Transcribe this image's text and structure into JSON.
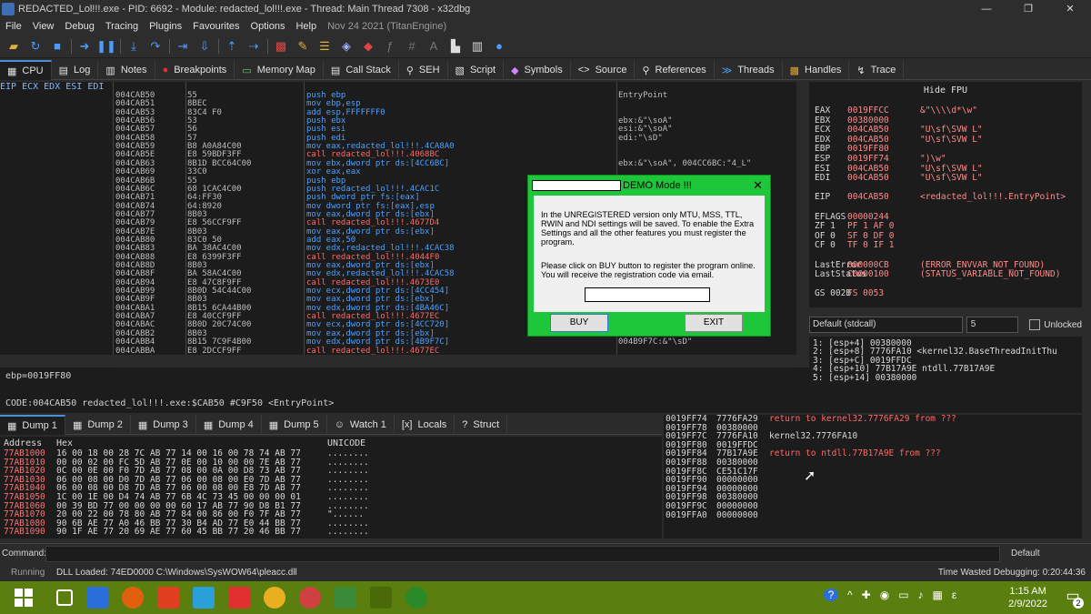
{
  "window": {
    "title": "REDACTED_Lol!!!.exe - PID: 6692 - Module: redacted_lol!!!.exe - Thread: Main Thread 7308 - x32dbg",
    "min": "—",
    "max": "❐",
    "close": "✕"
  },
  "menu": {
    "items": [
      "File",
      "View",
      "Debug",
      "Tracing",
      "Plugins",
      "Favourites",
      "Options",
      "Help"
    ],
    "date": "Nov 24 2021 (TitanEngine)"
  },
  "tabs": [
    {
      "label": "CPU",
      "icon": "▦"
    },
    {
      "label": "Log",
      "icon": "▤"
    },
    {
      "label": "Notes",
      "icon": "▥"
    },
    {
      "label": "Breakpoints",
      "icon": "●"
    },
    {
      "label": "Memory Map",
      "icon": "▭"
    },
    {
      "label": "Call Stack",
      "icon": "▤"
    },
    {
      "label": "SEH",
      "icon": "⚲"
    },
    {
      "label": "Script",
      "icon": "▧"
    },
    {
      "label": "Symbols",
      "icon": "◆"
    },
    {
      "label": "Source",
      "icon": "<>"
    },
    {
      "label": "References",
      "icon": "⚲"
    },
    {
      "label": "Threads",
      "icon": "≫"
    },
    {
      "label": "Handles",
      "icon": "▩"
    },
    {
      "label": "Trace",
      "icon": "↯"
    }
  ],
  "disasm": {
    "reg_header": "EIP ECX EDX ESI EDI",
    "rows": [
      {
        "a": "004CAB50",
        "b": "55",
        "i": "push ebp",
        "k": "push",
        "c": "EntryPoint"
      },
      {
        "a": "004CAB51",
        "b": "8BEC",
        "i": "mov ebp,esp",
        "k": "mov",
        "c": ""
      },
      {
        "a": "004CAB53",
        "b": "83C4 F0",
        "i": "add esp,FFFFFFF0",
        "k": "add",
        "c": ""
      },
      {
        "a": "004CAB56",
        "b": "53",
        "i": "push ebx",
        "k": "push",
        "c": "ebx:&\"\\soA\""
      },
      {
        "a": "004CAB57",
        "b": "56",
        "i": "push esi",
        "k": "push",
        "c": "esi:&\"\\soA\""
      },
      {
        "a": "004CAB58",
        "b": "57",
        "i": "push edi",
        "k": "push",
        "c": "edi:\"\\sD\""
      },
      {
        "a": "004CAB59",
        "b": "B8 A0A84C00",
        "i": "mov eax,redacted_lol!!!.4CA8A0",
        "k": "mov",
        "c": ""
      },
      {
        "a": "004CAB5E",
        "b": "E8 59BDF3FF",
        "i": "call redacted_lol!!!.4068BC",
        "k": "call",
        "c": ""
      },
      {
        "a": "004CAB63",
        "b": "8B1D BCC64C00",
        "i": "mov ebx,dword ptr ds:[4CC6BC]",
        "k": "mov",
        "c": "ebx:&\"\\soA\", 004CC6BC:\"4_L\""
      },
      {
        "a": "004CAB69",
        "b": "33C0",
        "i": "xor eax,eax",
        "k": "xor",
        "c": ""
      },
      {
        "a": "004CAB6B",
        "b": "55",
        "i": "push ebp",
        "k": "push",
        "c": ""
      },
      {
        "a": "004CAB6C",
        "b": "68 1CAC4C00",
        "i": "push redacted_lol!!!.4CAC1C",
        "k": "push",
        "c": ""
      },
      {
        "a": "004CAB71",
        "b": "64:FF30",
        "i": "push dword ptr fs:[eax]",
        "k": "push",
        "c": ""
      },
      {
        "a": "004CAB74",
        "b": "64:8920",
        "i": "mov dword ptr fs:[eax],esp",
        "k": "mov",
        "c": ""
      },
      {
        "a": "004CAB77",
        "b": "8B03",
        "i": "mov eax,dword ptr ds:[ebx]",
        "k": "mov",
        "c": ""
      },
      {
        "a": "004CAB79",
        "b": "E8 56CCF9FF",
        "i": "call redacted_lol!!!.4677D4",
        "k": "call",
        "c": ""
      },
      {
        "a": "004CAB7E",
        "b": "8B03",
        "i": "mov eax,dword ptr ds:[ebx]",
        "k": "mov",
        "c": ""
      },
      {
        "a": "004CAB80",
        "b": "83C0 50",
        "i": "add eax,50",
        "k": "add",
        "c": ""
      },
      {
        "a": "004CAB83",
        "b": "BA 38AC4C00",
        "i": "mov edx,redacted_lol!!!.4CAC38",
        "k": "mov",
        "c": "m\""
      },
      {
        "a": "004CAB88",
        "b": "E8 6399F3FF",
        "i": "call redacted_lol!!!.4044F0",
        "k": "call",
        "c": ""
      },
      {
        "a": "004CAB8D",
        "b": "8B03",
        "i": "mov eax,dword ptr ds:[ebx]",
        "k": "mov",
        "c": ""
      },
      {
        "a": "004CAB8F",
        "b": "BA 58AC4C00",
        "i": "mov edx,redacted_lol!!!.4CAC58",
        "k": "mov",
        "c": "28\""
      },
      {
        "a": "004CAB94",
        "b": "E8 47C8F9FF",
        "i": "call redacted_lol!!!.4673E0",
        "k": "call",
        "c": ""
      },
      {
        "a": "004CAB99",
        "b": "8B0D 54C44C00",
        "i": "mov ecx,dword ptr ds:[4CC454]",
        "k": "mov",
        "c": ""
      },
      {
        "a": "004CAB9F",
        "b": "8B03",
        "i": "mov eax,dword ptr ds:[ebx]",
        "k": "mov",
        "c": ""
      },
      {
        "a": "004CABA1",
        "b": "8B15 6CA44B00",
        "i": "mov edx,dword ptr ds:[4BA46C]",
        "k": "mov",
        "c": ""
      },
      {
        "a": "004CABA7",
        "b": "E8 40CCF9FF",
        "i": "call redacted_lol!!!.4677EC",
        "k": "call",
        "c": ""
      },
      {
        "a": "004CABAC",
        "b": "8B0D 20C74C00",
        "i": "mov ecx,dword ptr ds:[4CC720]",
        "k": "mov",
        "c": ""
      },
      {
        "a": "004CABB2",
        "b": "8B03",
        "i": "mov eax,dword ptr ds:[ebx]",
        "k": "mov",
        "c": ""
      },
      {
        "a": "004CABB4",
        "b": "8B15 7C9F4B00",
        "i": "mov edx,dword ptr ds:[4B9F7C]",
        "k": "mov",
        "c": "004B9F7C:&\"\\sD\""
      },
      {
        "a": "004CABBA",
        "b": "E8 2DCCF9FF",
        "i": "call redacted_lol!!!.4677EC",
        "k": "call",
        "c": ""
      }
    ]
  },
  "info": {
    "line1": "ebp=0019FF80",
    "line2": "CODE:004CAB50 redacted_lol!!!.exe:$CAB50 #C9F50 <EntryPoint>"
  },
  "registers": {
    "header": "Hide FPU",
    "rows": [
      {
        "n": "EAX",
        "v": "0019FFCC",
        "s": "&\"\\\\\\\\d*\\w\""
      },
      {
        "n": "EBX",
        "v": "00380000",
        "s": ""
      },
      {
        "n": "ECX",
        "v": "004CAB50",
        "s": "\"U\\sf\\SVW  L\""
      },
      {
        "n": "EDX",
        "v": "004CAB50",
        "s": "\"U\\sf\\SVW  L\""
      },
      {
        "n": "EBP",
        "v": "0019FF80",
        "s": ""
      },
      {
        "n": "ESP",
        "v": "0019FF74",
        "s": "\")\\w\""
      },
      {
        "n": "ESI",
        "v": "004CAB50",
        "s": "\"U\\sf\\SVW  L\""
      },
      {
        "n": "EDI",
        "v": "004CAB50",
        "s": "\"U\\sf\\SVW  L\""
      },
      {
        "n": "",
        "v": "",
        "s": ""
      },
      {
        "n": "EIP",
        "v": "004CAB50",
        "s": "<redacted_lol!!!.EntryPoint>"
      },
      {
        "n": "",
        "v": "",
        "s": ""
      },
      {
        "n": "EFLAGS",
        "v": "00000244",
        "s": ""
      },
      {
        "n": "ZF 1",
        "v": "PF 1  AF 0",
        "s": ""
      },
      {
        "n": "OF 0",
        "v": "SF 0  DF 0",
        "s": ""
      },
      {
        "n": "CF 0",
        "v": "TF 0  IF 1",
        "s": ""
      },
      {
        "n": "",
        "v": "",
        "s": ""
      },
      {
        "n": "LastError",
        "v": "000000CB",
        "s": "(ERROR_ENVVAR_NOT_FOUND)"
      },
      {
        "n": "LastStatus",
        "v": "C0000100",
        "s": "(STATUS_VARIABLE_NOT_FOUND)"
      },
      {
        "n": "",
        "v": "",
        "s": ""
      },
      {
        "n": "GS 002B",
        "v": "FS 0053",
        "s": ""
      }
    ]
  },
  "callconv": {
    "selected": "Default (stdcall)",
    "count": "5",
    "unlocked": "Unlocked"
  },
  "args": [
    "1: [esp+4] 00380000",
    "2: [esp+8] 7776FA10 <kernel32.BaseThreadInitThu",
    "3: [esp+C] 0019FFDC",
    "4: [esp+10] 77B17A9E ntdll.77B17A9E",
    "5: [esp+14] 00380000"
  ],
  "dumptabs": [
    {
      "label": "Dump 1",
      "icon": "▦"
    },
    {
      "label": "Dump 2",
      "icon": "▦"
    },
    {
      "label": "Dump 3",
      "icon": "▦"
    },
    {
      "label": "Dump 4",
      "icon": "▦"
    },
    {
      "label": "Dump 5",
      "icon": "▦"
    },
    {
      "label": "Watch 1",
      "icon": "☺"
    },
    {
      "label": "Locals",
      "icon": "[x]"
    },
    {
      "label": "Struct",
      "icon": "?"
    }
  ],
  "dump": {
    "col_addr": "Address",
    "col_hex": "Hex",
    "col_uni": "UNICODE",
    "rows": [
      {
        "a": "77AB1000",
        "h": "16 00 18 00 28 7C AB 77 14 00 16 00 78 74 AB 77",
        "u": "........"
      },
      {
        "a": "77AB1010",
        "h": "00 00 02 00 FC 5D AB 77 0E 00 10 00 00 7E AB 77",
        "u": "........"
      },
      {
        "a": "77AB1020",
        "h": "0C 00 0E 00 F0 7D AB 77 08 00 0A 00 D8 73 AB 77",
        "u": "........"
      },
      {
        "a": "77AB1030",
        "h": "06 00 08 00 D0 7D AB 77 06 00 08 00 E0 7D AB 77",
        "u": "........"
      },
      {
        "a": "77AB1040",
        "h": "06 00 08 00 D8 7D AB 77 06 00 08 00 E8 7D AB 77",
        "u": "........"
      },
      {
        "a": "77AB1050",
        "h": "1C 00 1E 00 D4 74 AB 77 6B 4C 73 45 00 00 00 01",
        "u": "........"
      },
      {
        "a": "77AB1060",
        "h": "00 39 BD 77 00 00 00 00 60 17 AB 77 90 D8 B1 77",
        "u": "........"
      },
      {
        "a": "77AB1070",
        "h": "20 00 22 00 78 80 AB 77 84 00 86 00 F0 7F AB 77",
        "u": "\"......"
      },
      {
        "a": "77AB1080",
        "h": "90 6B AE 77 A0 46 BB 77 30 B4 AD 77 E0 44 BB 77",
        "u": "........"
      },
      {
        "a": "77AB1090",
        "h": "90 1F AE 77 20 69 AE 77 60 45 BB 77 20 46 BB 77",
        "u": "........"
      }
    ]
  },
  "stack": {
    "rows": [
      {
        "a": "0019FF74",
        "v": "7776FA29",
        "c": "return to kernel32.7776FA29 from ???",
        "r": true
      },
      {
        "a": "0019FF78",
        "v": "00380000",
        "c": "",
        "r": false
      },
      {
        "a": "0019FF7C",
        "v": "7776FA10",
        "c": "kernel32.7776FA10",
        "r": false
      },
      {
        "a": "0019FF80",
        "v": "0019FFDC",
        "c": "",
        "r": false
      },
      {
        "a": "0019FF84",
        "v": "77B17A9E",
        "c": "return to ntdll.77B17A9E from ???",
        "r": true
      },
      {
        "a": "0019FF88",
        "v": "00380000",
        "c": "",
        "r": false
      },
      {
        "a": "0019FF8C",
        "v": "CE51C17F",
        "c": "",
        "r": false
      },
      {
        "a": "0019FF90",
        "v": "00000000",
        "c": "",
        "r": false
      },
      {
        "a": "0019FF94",
        "v": "00000000",
        "c": "",
        "r": false
      },
      {
        "a": "0019FF98",
        "v": "00380000",
        "c": "",
        "r": false
      },
      {
        "a": "0019FF9C",
        "v": "00000000",
        "c": "",
        "r": false
      },
      {
        "a": "0019FFA0",
        "v": "00000000",
        "c": "",
        "r": false
      }
    ]
  },
  "command": {
    "label": "Command:",
    "default": "Default"
  },
  "status": {
    "state": "Running",
    "message": "DLL Loaded: 74ED0000 C:\\Windows\\SysWOW64\\pleacc.dll",
    "time": "Time Wasted Debugging: 0:20:44:36"
  },
  "taskbar": {
    "time": "1:15 AM",
    "date": "2/9/2022",
    "notif": "2",
    "lang": "ε"
  },
  "dialog": {
    "title": "DEMO Mode !!!",
    "close": "✕",
    "p1": "In the UNREGISTERED version only MTU, MSS, TTL, RWIN and NDI settings will be saved. To enable the Extra Settings and all the other features you must register the program.",
    "p2": "Please click on BUY button to register the program online. You will receive the registration code via email.",
    "buy": "BUY",
    "exit": "EXIT"
  },
  "colors": {
    "accent": "#1ec73a",
    "taskbar": "#5a7f0f",
    "addr_red": "#ff7070"
  }
}
